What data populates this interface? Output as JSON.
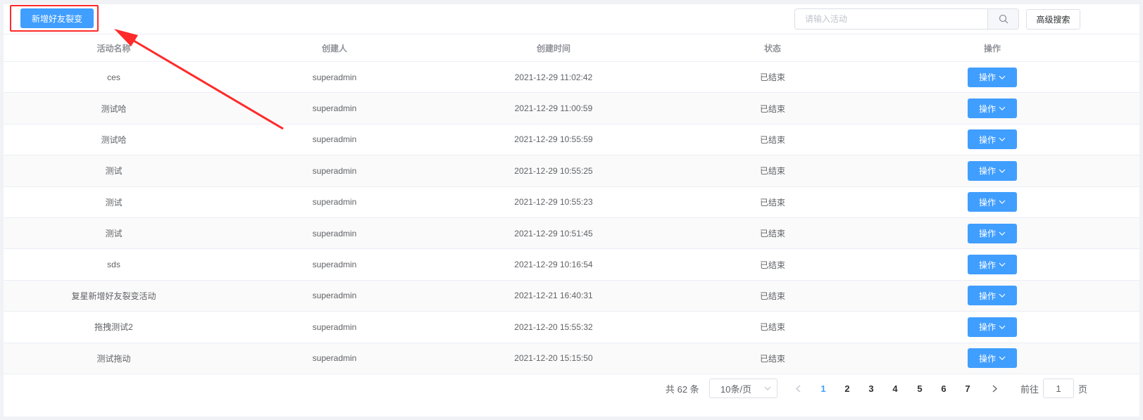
{
  "toolbar": {
    "new_button_label": "新增好友裂变",
    "search_placeholder": "请输入活动",
    "search_value": "",
    "advanced_search_label": "高级搜索"
  },
  "table": {
    "columns": [
      "活动名称",
      "创建人",
      "创建时间",
      "状态",
      "操作"
    ],
    "rows": [
      {
        "name": "ces",
        "creator": "superadmin",
        "time": "2021-12-29 11:02:42",
        "status": "已结束",
        "action": "操作"
      },
      {
        "name": "测试哈",
        "creator": "superadmin",
        "time": "2021-12-29 11:00:59",
        "status": "已结束",
        "action": "操作"
      },
      {
        "name": "测试哈",
        "creator": "superadmin",
        "time": "2021-12-29 10:55:59",
        "status": "已结束",
        "action": "操作"
      },
      {
        "name": "测试",
        "creator": "superadmin",
        "time": "2021-12-29 10:55:25",
        "status": "已结束",
        "action": "操作"
      },
      {
        "name": "测试",
        "creator": "superadmin",
        "time": "2021-12-29 10:55:23",
        "status": "已结束",
        "action": "操作"
      },
      {
        "name": "测试",
        "creator": "superadmin",
        "time": "2021-12-29 10:51:45",
        "status": "已结束",
        "action": "操作"
      },
      {
        "name": "sds",
        "creator": "superadmin",
        "time": "2021-12-29 10:16:54",
        "status": "已结束",
        "action": "操作"
      },
      {
        "name": "复星新增好友裂变活动",
        "creator": "superadmin",
        "time": "2021-12-21 16:40:31",
        "status": "已结束",
        "action": "操作"
      },
      {
        "name": "拖拽测试2",
        "creator": "superadmin",
        "time": "2021-12-20 15:55:32",
        "status": "已结束",
        "action": "操作"
      },
      {
        "name": "测试拖动",
        "creator": "superadmin",
        "time": "2021-12-20 15:15:50",
        "status": "已结束",
        "action": "操作"
      }
    ]
  },
  "pagination": {
    "total_text": "共 62 条",
    "page_size": "10条/页",
    "pages": [
      "1",
      "2",
      "3",
      "4",
      "5",
      "6",
      "7"
    ],
    "current_page": "1",
    "goto_prefix": "前往",
    "goto_value": "1",
    "goto_suffix": "页"
  },
  "colors": {
    "primary": "#409eff",
    "annotation": "#ff2a2a"
  },
  "icons": {
    "search": "search-icon",
    "dropdown": "chevron-down-icon",
    "prev": "chevron-left-icon",
    "next": "chevron-right-icon"
  }
}
